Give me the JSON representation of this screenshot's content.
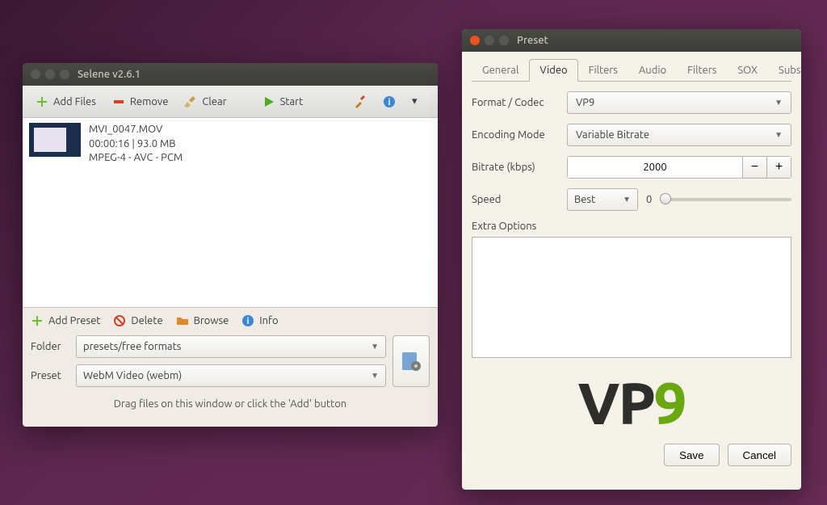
{
  "main": {
    "title": "Selene v2.6.1",
    "toolbar": {
      "add_files": "Add Files",
      "remove": "Remove",
      "clear": "Clear",
      "start": "Start"
    },
    "file": {
      "name": "MVI_0047.MOV",
      "duration_size": "00:00:16 | 93.0 MB",
      "codec": "MPEG-4 - AVC - PCM"
    },
    "mini": {
      "add_preset": "Add Preset",
      "delete": "Delete",
      "browse": "Browse",
      "info": "Info"
    },
    "folder_label": "Folder",
    "folder_value": "presets/free formats",
    "preset_label": "Preset",
    "preset_value": "WebM Video (webm)",
    "hint": "Drag files on this window or click the 'Add' button"
  },
  "preset": {
    "title": "Preset",
    "tabs": [
      "General",
      "Video",
      "Filters",
      "Audio",
      "Filters",
      "SOX",
      "Subs"
    ],
    "active_tab": 1,
    "format_label": "Format / Codec",
    "format_value": "VP9",
    "mode_label": "Encoding Mode",
    "mode_value": "Variable Bitrate",
    "bitrate_label": "Bitrate (kbps)",
    "bitrate_value": "2000",
    "speed_label": "Speed",
    "speed_value": "Best",
    "speed_slider_pos": "0",
    "extra_label": "Extra Options",
    "extra_value": "",
    "logo": {
      "v": "V",
      "p": "P",
      "nine": "9"
    },
    "save": "Save",
    "cancel": "Cancel"
  }
}
